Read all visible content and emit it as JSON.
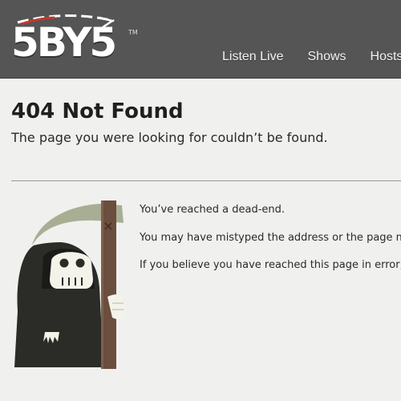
{
  "header": {
    "logo_text": "5BY5",
    "logo_tm": "TM",
    "nav": [
      {
        "label": "Listen Live"
      },
      {
        "label": "Shows"
      },
      {
        "label": "Hosts"
      }
    ]
  },
  "main": {
    "title": "404 Not Found",
    "subtitle": "The page you were looking for couldn’t be found.",
    "messages": [
      "You’ve reached a dead-end.",
      "You may have mistyped the address or the page ma",
      "If you believe you have reached this page in error, p"
    ]
  },
  "colors": {
    "header_bg": "#555555",
    "page_bg": "#f0f0ee",
    "logo_accent": "#c0392b",
    "reaper_robe": "#2b2b28",
    "reaper_scythe": "#a8ae94",
    "reaper_staff": "#6b4e3d"
  },
  "icons": {
    "reaper": "grim-reaper-illustration"
  }
}
